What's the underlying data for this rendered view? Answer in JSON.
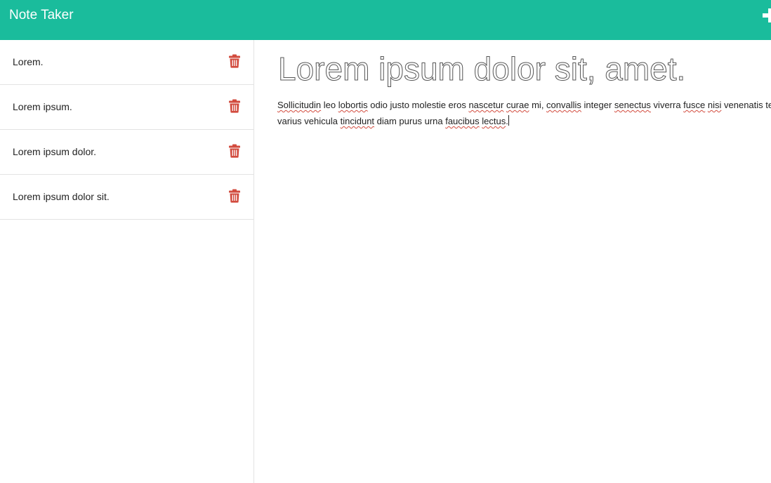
{
  "app": {
    "title": "Note Taker",
    "new_note_icon": "plus-icon"
  },
  "colors": {
    "navbar": "#1abc9c",
    "delete": "#d24b3e",
    "divider": "#e3e3e3"
  },
  "notes": [
    {
      "title": "Lorem.",
      "delete_icon": "trash-icon"
    },
    {
      "title": "Lorem ipsum.",
      "delete_icon": "trash-icon"
    },
    {
      "title": "Lorem ipsum dolor.",
      "delete_icon": "trash-icon"
    },
    {
      "title": "Lorem ipsum dolor sit.",
      "delete_icon": "trash-icon"
    }
  ],
  "editor": {
    "title_value": "Lorem ipsum dolor sit, amet.",
    "text_segments": [
      {
        "text": "Sollicitudin",
        "misspelled": true
      },
      {
        "text": " leo ",
        "misspelled": false
      },
      {
        "text": "lobortis",
        "misspelled": true
      },
      {
        "text": " odio justo molestie eros ",
        "misspelled": false
      },
      {
        "text": "nascetur",
        "misspelled": true
      },
      {
        "text": " ",
        "misspelled": false
      },
      {
        "text": "curae",
        "misspelled": true
      },
      {
        "text": " mi, ",
        "misspelled": false
      },
      {
        "text": "convallis",
        "misspelled": true
      },
      {
        "text": " integer ",
        "misspelled": false
      },
      {
        "text": "senectus",
        "misspelled": true
      },
      {
        "text": " viverra ",
        "misspelled": false
      },
      {
        "text": "fusce",
        "misspelled": true
      },
      {
        "text": " ",
        "misspelled": false
      },
      {
        "text": "nisi",
        "misspelled": true
      },
      {
        "text": " venenatis tellus, varius vehicula ",
        "misspelled": false
      },
      {
        "text": "tincidunt",
        "misspelled": true
      },
      {
        "text": " diam purus urna ",
        "misspelled": false
      },
      {
        "text": "faucibus",
        "misspelled": true
      },
      {
        "text": " ",
        "misspelled": false
      },
      {
        "text": "lectus",
        "misspelled": true
      },
      {
        "text": ".",
        "misspelled": false
      }
    ]
  }
}
